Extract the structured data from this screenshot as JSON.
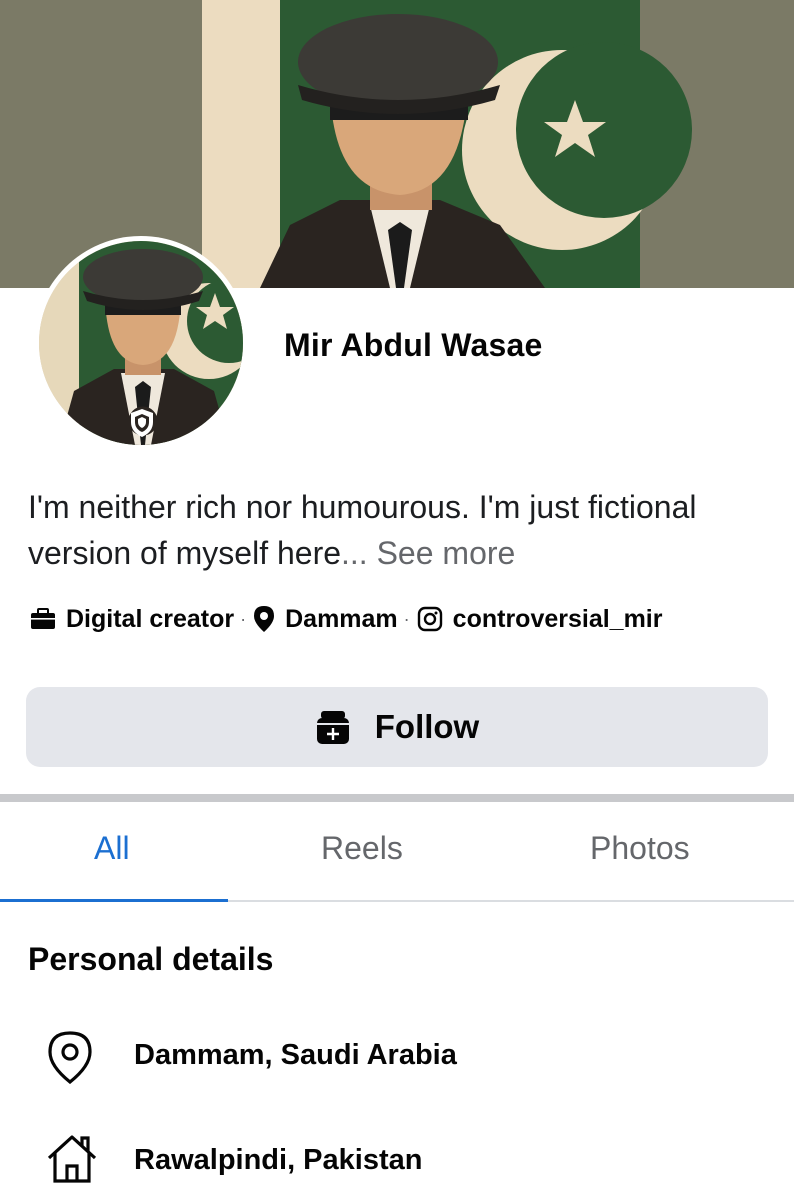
{
  "profile": {
    "name": "Mir Abdul Wasae",
    "bio": "I'm neither rich nor humourous. I'm just fictional version of myself here",
    "see_more": "... See more"
  },
  "meta": {
    "category": "Digital creator",
    "location": "Dammam",
    "instagram": "controversial_mir",
    "separator": "·"
  },
  "actions": {
    "follow_label": "Follow"
  },
  "tabs": [
    {
      "label": "All",
      "active": true
    },
    {
      "label": "Reels",
      "active": false
    },
    {
      "label": "Photos",
      "active": false
    }
  ],
  "personal_details": {
    "title": "Personal details",
    "items": [
      {
        "icon": "location-pin-icon",
        "text": "Dammam, Saudi Arabia"
      },
      {
        "icon": "home-icon",
        "text": "Rawalpindi, Pakistan"
      }
    ]
  },
  "colors": {
    "accent": "#1b6fd1",
    "button_bg": "#e4e6eb",
    "muted_text": "#65676b",
    "flag_green": "#2e5a33"
  },
  "icons": {
    "cover": "cover-photo",
    "avatar": "profile-avatar",
    "badge": "shield-badge-icon",
    "category": "briefcase-icon",
    "location": "location-pin-icon",
    "instagram": "instagram-icon",
    "follow": "add-follow-icon"
  }
}
